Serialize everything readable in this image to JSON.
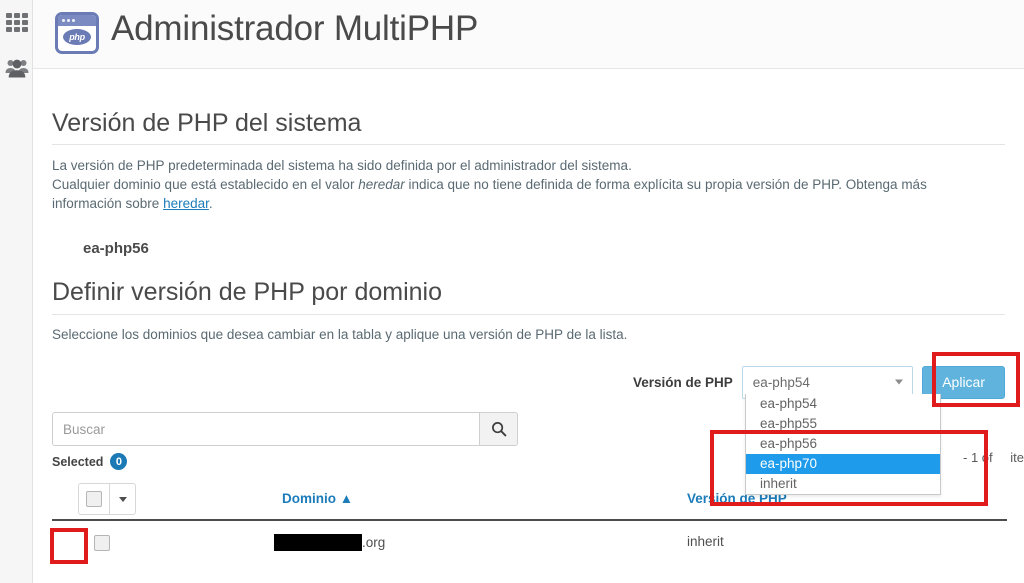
{
  "rail": {
    "items": [
      {
        "name": "grid-icon",
        "label": "Aplicaciones"
      },
      {
        "name": "users-icon",
        "label": "Usuarios"
      }
    ]
  },
  "header": {
    "title": "Administrador MultiPHP",
    "icon": "php-icon"
  },
  "system_section": {
    "title": "Versión de PHP del sistema",
    "paragraph_line1": "La versión de PHP predeterminada del sistema ha sido definida por el administrador del sistema.",
    "paragraph_line2_pre": "Cualquier dominio que está establecido en el valor ",
    "paragraph_line2_em": "heredar",
    "paragraph_line2_post": " indica que no tiene definida de forma explícita su propia versión de PHP. Obtenga más",
    "paragraph_line3_pre": "información sobre ",
    "paragraph_line3_link": "heredar",
    "paragraph_line3_post": ".",
    "system_version": "ea-php56"
  },
  "domain_section": {
    "title": "Definir versión de PHP por dominio",
    "description": "Seleccione los dominios que desea cambiar en la tabla y aplique una versión de PHP de la lista."
  },
  "apply_bar": {
    "label": "Versión de PHP",
    "selected_value": "ea-php54",
    "apply_label": "Aplicar",
    "caret_icon": "chevron-down-icon"
  },
  "dropdown": {
    "open": true,
    "options": [
      {
        "label": "ea-php54",
        "selected": false
      },
      {
        "label": "ea-php55",
        "selected": false
      },
      {
        "label": "ea-php56",
        "selected": false
      },
      {
        "label": "ea-php70",
        "selected": true
      },
      {
        "label": "inherit",
        "selected": false
      }
    ]
  },
  "search": {
    "value": "",
    "placeholder": "Buscar",
    "icon": "search-icon"
  },
  "selection": {
    "label": "Selected",
    "count": "0"
  },
  "pagination": {
    "text": "- 1 of ",
    "items_label": "items"
  },
  "table": {
    "columns": [
      {
        "label": "Dominio",
        "sort": "▲"
      },
      {
        "label": "Versión de PHP",
        "sort": ""
      }
    ],
    "header_caret_icon": "chevron-down-icon",
    "rows": [
      {
        "domain_redacted": true,
        "domain_suffix": ".org",
        "version": "inherit",
        "checked": false
      }
    ]
  },
  "annotations": {
    "color": "#e01b1b",
    "boxes": [
      "apply-button",
      "dropdown-options",
      "row-checkbox"
    ]
  }
}
